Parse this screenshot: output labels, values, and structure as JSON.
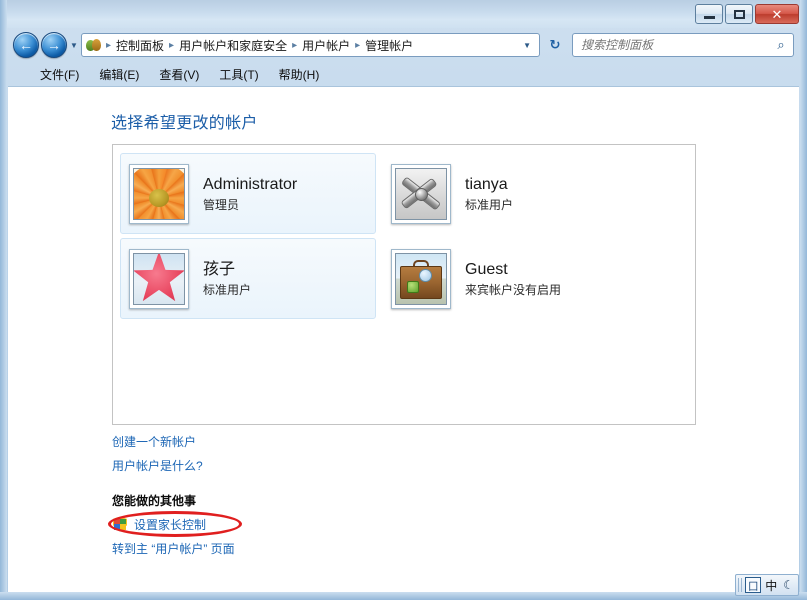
{
  "window": {
    "caption_buttons": {
      "minimize_label": "—",
      "maximize_label": "□",
      "close_label": "✕"
    }
  },
  "addressbar": {
    "back_label": "←",
    "forward_label": "→",
    "history_dropdown_label": "▼",
    "control_panel_icon": "control-panel-icon",
    "breadcrumbs": [
      "控制面板",
      "用户帐户和家庭安全",
      "用户帐户",
      "管理帐户"
    ],
    "separator": "▸",
    "chevron_label": "▼",
    "refresh_label": "↻",
    "search_placeholder": "搜索控制面板",
    "search_value": "",
    "search_icon": "search-icon"
  },
  "menubar": {
    "items": [
      "文件(F)",
      "编辑(E)",
      "查看(V)",
      "工具(T)",
      "帮助(H)"
    ]
  },
  "page": {
    "title": "选择希望更改的帐户",
    "accounts": [
      {
        "name": "Administrator",
        "role": "管理员",
        "picture": "flower-picture",
        "highlighted": true
      },
      {
        "name": "tianya",
        "role": "标准用户",
        "picture": "tools-picture",
        "highlighted": false
      },
      {
        "name": "孩子",
        "role": "标准用户",
        "picture": "starfish-picture",
        "highlighted": true
      },
      {
        "name": "Guest",
        "role": "来宾帐户没有启用",
        "picture": "briefcase-picture",
        "highlighted": false
      }
    ],
    "links": {
      "create_account": "创建一个新帐户",
      "what_is_account": "用户帐户是什么?",
      "other_heading": "您能做的其他事",
      "parental_controls": "设置家长控制",
      "go_to_main": "转到主 “用户帐户” 页面"
    },
    "annotation": {
      "shape": "ellipse",
      "color": "#e01f1f",
      "targets": "设置家长控制"
    }
  },
  "ime": {
    "icon_label": "囗",
    "mode": "中",
    "moon_label": "☾"
  }
}
